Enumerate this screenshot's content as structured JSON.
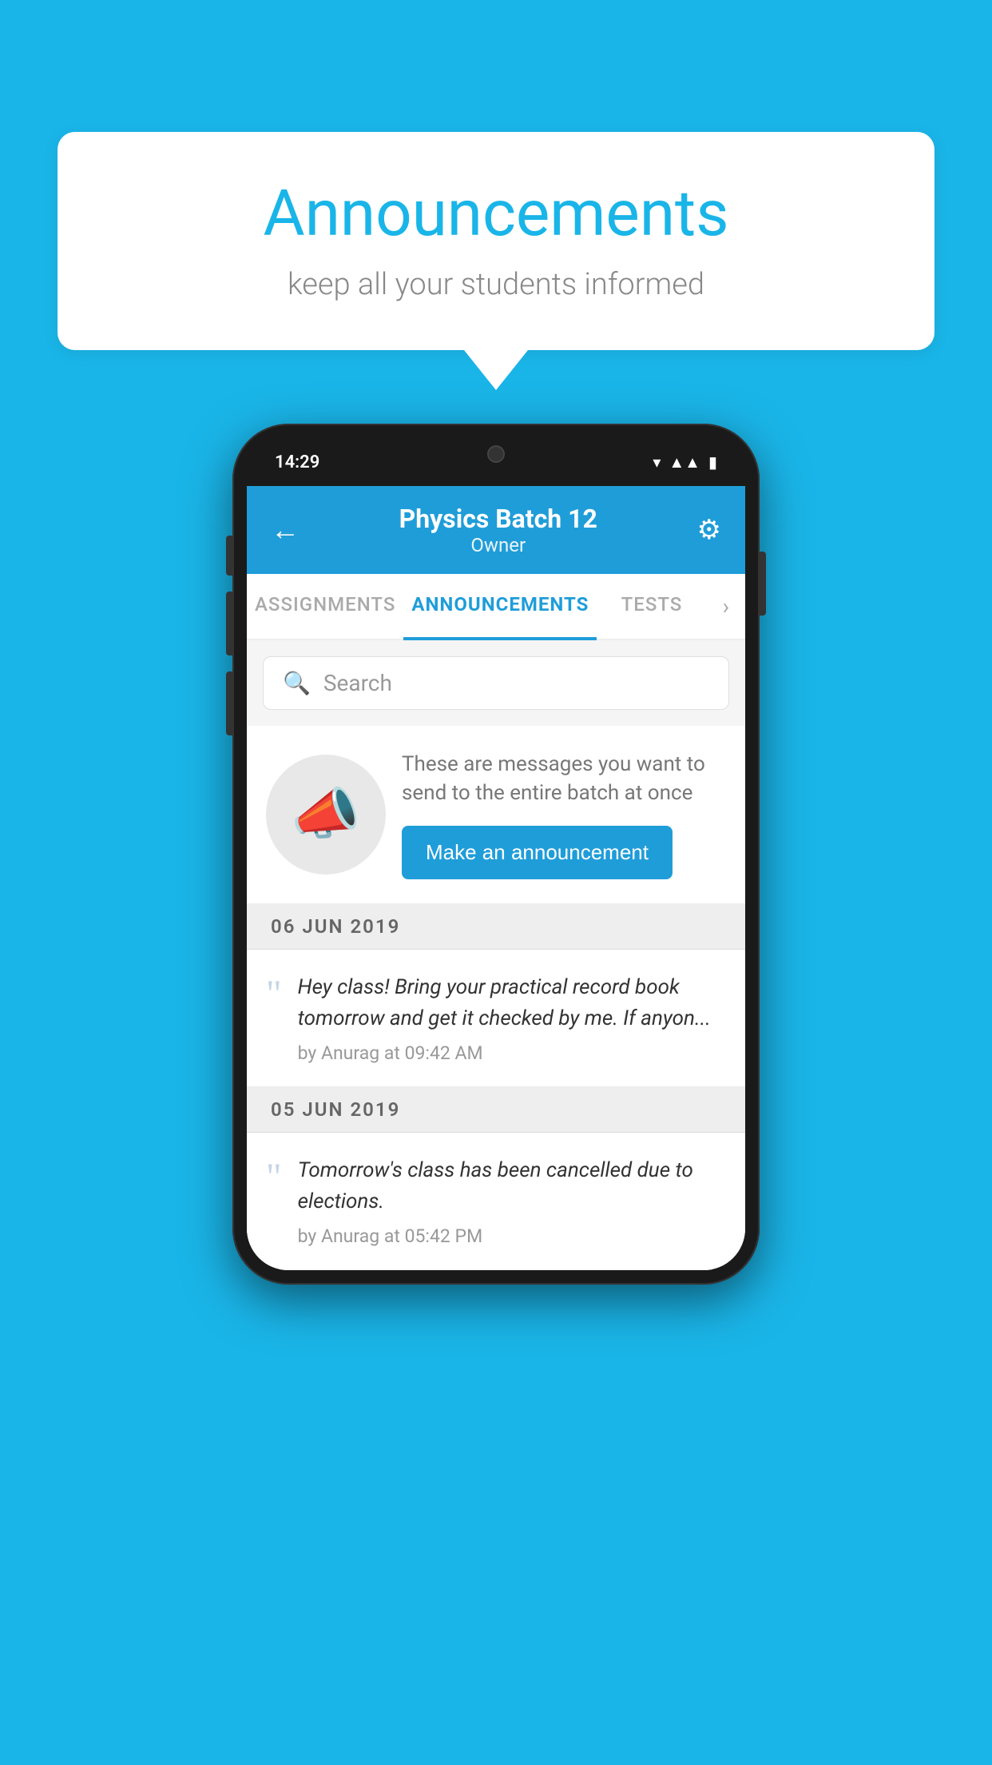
{
  "background_color": "#1ab5e8",
  "speech_bubble": {
    "title": "Announcements",
    "subtitle": "keep all your students informed"
  },
  "phone": {
    "status_bar": {
      "time": "14:29"
    },
    "header": {
      "title": "Physics Batch 12",
      "subtitle": "Owner",
      "back_label": "←",
      "gear_label": "⚙"
    },
    "tabs": [
      {
        "label": "ASSIGNMENTS",
        "active": false
      },
      {
        "label": "ANNOUNCEMENTS",
        "active": true
      },
      {
        "label": "TESTS",
        "active": false
      }
    ],
    "tabs_more": "›",
    "search": {
      "placeholder": "Search"
    },
    "promo": {
      "description": "These are messages you want to send to the entire batch at once",
      "button_label": "Make an announcement"
    },
    "announcements": [
      {
        "date": "06  JUN  2019",
        "items": [
          {
            "text": "Hey class! Bring your practical record book tomorrow and get it checked by me. If anyon...",
            "meta": "by Anurag at 09:42 AM"
          }
        ]
      },
      {
        "date": "05  JUN  2019",
        "items": [
          {
            "text": "Tomorrow's class has been cancelled due to elections.",
            "meta": "by Anurag at 05:42 PM"
          }
        ]
      }
    ]
  }
}
